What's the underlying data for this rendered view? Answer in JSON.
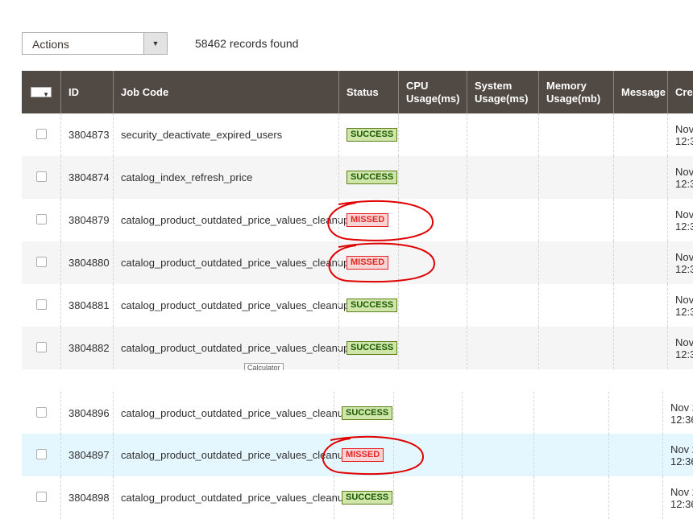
{
  "toolbar": {
    "actions_label": "Actions",
    "records_found": "58462 records found"
  },
  "columns": {
    "id": "ID",
    "job_code": "Job Code",
    "status": "Status",
    "cpu_line1": "CPU",
    "cpu_line2": "Usage(ms)",
    "sys_line1": "System",
    "sys_line2": "Usage(ms)",
    "mem_line1": "Memory",
    "mem_line2": "Usage(mb)",
    "message": "Message",
    "created": "Crea"
  },
  "rows": [
    {
      "id": "3804873",
      "job_code": "security_deactivate_expired_users",
      "status": "SUCCESS",
      "created_line1": "Nov",
      "created_line2": "12:3"
    },
    {
      "id": "3804874",
      "job_code": "catalog_index_refresh_price",
      "status": "SUCCESS",
      "created_line1": "Nov",
      "created_line2": "12:3"
    },
    {
      "id": "3804879",
      "job_code": "catalog_product_outdated_price_values_cleanup",
      "status": "MISSED",
      "created_line1": "Nov",
      "created_line2": "12:3"
    },
    {
      "id": "3804880",
      "job_code": "catalog_product_outdated_price_values_cleanup",
      "status": "MISSED",
      "created_line1": "Nov",
      "created_line2": "12:3"
    },
    {
      "id": "3804881",
      "job_code": "catalog_product_outdated_price_values_cleanup",
      "status": "SUCCESS",
      "created_line1": "Nov",
      "created_line2": "12:3"
    },
    {
      "id": "3804882",
      "job_code": "catalog_product_outdated_price_values_cleanup",
      "status": "SUCCESS",
      "created_line1": "Nov",
      "created_line2": "12:3"
    },
    {
      "id": "3804896",
      "job_code": "catalog_product_outdated_price_values_cleanup",
      "status": "SUCCESS",
      "created_line1": "Nov 2",
      "created_line2": "12:36"
    },
    {
      "id": "3804897",
      "job_code": "catalog_product_outdated_price_values_cleanup",
      "status": "MISSED",
      "created_line1": "Nov 2",
      "created_line2": "12:36"
    },
    {
      "id": "3804898",
      "job_code": "catalog_product_outdated_price_values_cleanup",
      "status": "SUCCESS",
      "created_line1": "Nov 2",
      "created_line2": "12:36"
    }
  ],
  "tooltip": "Calculator",
  "icons": {
    "dropdown": "chevron-down-icon"
  },
  "colors": {
    "header_bg": "#514943",
    "success": "#185b00",
    "missed": "#e22626",
    "annotation": "#e00000"
  }
}
